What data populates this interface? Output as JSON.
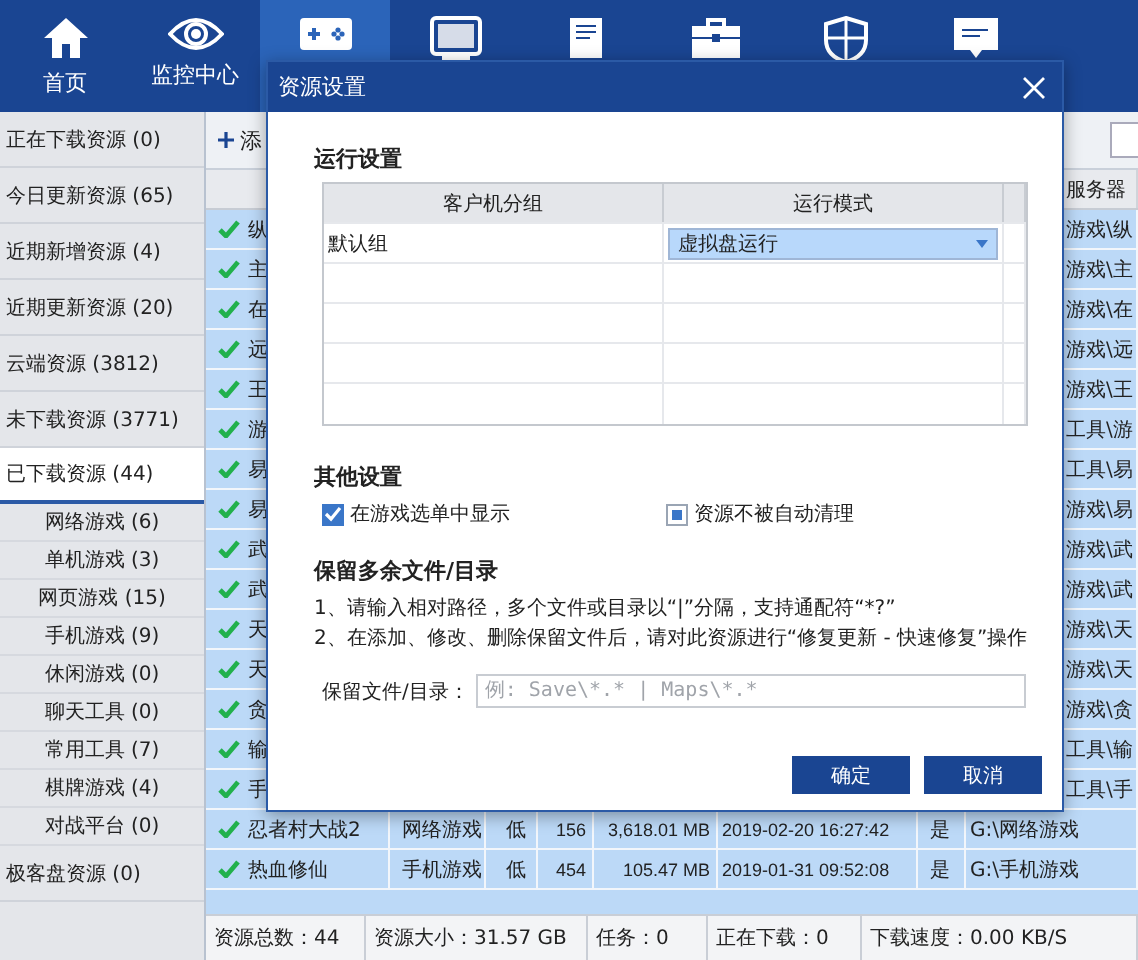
{
  "nav": [
    {
      "kind": "home",
      "label": "首页",
      "selected": false
    },
    {
      "kind": "eye",
      "label": "监控中心",
      "selected": false
    },
    {
      "kind": "gamepad",
      "selected": true
    },
    {
      "kind": "monitor",
      "selected": false
    },
    {
      "kind": "document",
      "selected": false
    },
    {
      "kind": "toolbox",
      "selected": false
    },
    {
      "kind": "shield",
      "selected": false
    },
    {
      "kind": "message",
      "selected": false
    }
  ],
  "sidebar": {
    "items": [
      {
        "label": "正在下载资源 (0)",
        "selected": false
      },
      {
        "label": "今日更新资源 (65)",
        "selected": false
      },
      {
        "label": "近期新增资源 (4)",
        "selected": false
      },
      {
        "label": "近期更新资源 (20)",
        "selected": false
      },
      {
        "label": "云端资源 (3812)",
        "selected": false
      },
      {
        "label": "未下载资源 (3771)",
        "selected": false
      },
      {
        "label": "已下载资源 (44)",
        "selected": true,
        "children": [
          {
            "label": "网络游戏 (6)"
          },
          {
            "label": "单机游戏 (3)"
          },
          {
            "label": "网页游戏 (15)"
          },
          {
            "label": "手机游戏 (9)"
          },
          {
            "label": "休闲游戏 (0)"
          },
          {
            "label": "聊天工具 (0)"
          },
          {
            "label": "常用工具 (7)"
          },
          {
            "label": "棋牌游戏 (4)"
          },
          {
            "label": "对战平台 (0)"
          }
        ]
      },
      {
        "label": "极客盘资源 (0)",
        "selected": false
      }
    ]
  },
  "toolbar": {
    "add_button": "添"
  },
  "table": {
    "visible_heading": "服务器",
    "rows": [
      {
        "kind": "covered",
        "name": "纵",
        "path": "游戏\\纵"
      },
      {
        "kind": "covered",
        "name": "主",
        "path": "游戏\\主"
      },
      {
        "kind": "covered",
        "name": "在",
        "path": "游戏\\在"
      },
      {
        "kind": "covered",
        "name": "远",
        "path": "游戏\\远"
      },
      {
        "kind": "covered",
        "name": "王",
        "path": "游戏\\王"
      },
      {
        "kind": "covered",
        "name": "游",
        "path": "工具\\游"
      },
      {
        "kind": "covered",
        "name": "易",
        "path": "工具\\易"
      },
      {
        "kind": "covered",
        "name": "易",
        "path": "游戏\\易"
      },
      {
        "kind": "covered",
        "name": "武",
        "path": "游戏\\武"
      },
      {
        "kind": "covered",
        "name": "武",
        "path": "游戏\\武"
      },
      {
        "kind": "covered",
        "name": "天",
        "path": "游戏\\天"
      },
      {
        "kind": "covered",
        "name": "天",
        "path": "游戏\\天"
      },
      {
        "kind": "covered",
        "name": "贪",
        "path": "游戏\\贪"
      },
      {
        "kind": "covered",
        "name": "输",
        "path": "工具\\输"
      },
      {
        "kind": "covered",
        "name": "手",
        "path": "工具\\手"
      },
      {
        "kind": "full",
        "name": "忍者村大战2",
        "type": "网络游戏",
        "priority": "低",
        "count": "156",
        "size": "3,618.01 MB",
        "date": "2019-02-20 16:27:42",
        "flag": "是",
        "path": "G:\\网络游戏"
      },
      {
        "kind": "full",
        "name": "热血修仙",
        "type": "手机游戏",
        "priority": "低",
        "count": "454",
        "size": "105.47 MB",
        "date": "2019-01-31 09:52:08",
        "flag": "是",
        "path": "G:\\手机游戏"
      }
    ]
  },
  "status_bar": [
    "资源总数：44",
    "资源大小：31.57 GB",
    "任务：0",
    "正在下载：0",
    "下载速度：0.00 KB/S"
  ],
  "dialog": {
    "title": "资源设置",
    "run_section": {
      "title": "运行设置",
      "columns": [
        "客户机分组",
        "运行模式"
      ],
      "rows": [
        {
          "group": "默认组",
          "mode": "虚拟盘运行"
        }
      ]
    },
    "other_section": {
      "title": "其他设置",
      "options": [
        {
          "kind": "tick",
          "label": "在游戏选单中显示",
          "checked": true
        },
        {
          "kind": "square",
          "label": "资源不被自动清理",
          "checked": true
        }
      ]
    },
    "keep_section": {
      "title": "保留多余文件/目录",
      "notes": [
        "1、请输入相对路径，多个文件或目录以“|”分隔，支持通配符“*?”",
        "2、在添加、修改、删除保留文件后，请对此资源进行“修复更新 - 快速修复”操作"
      ],
      "field_label": "保留文件/目录：",
      "placeholder": "例: Save\\*.* | Maps\\*.*"
    },
    "buttons": [
      "确定",
      "取消"
    ]
  }
}
